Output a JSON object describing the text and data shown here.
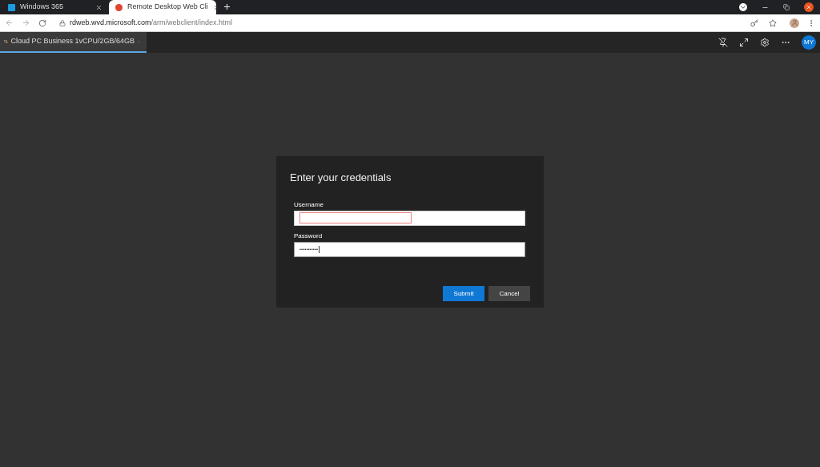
{
  "browser_tabs": [
    {
      "title": "Windows 365",
      "selected": false
    },
    {
      "title": "Remote Desktop Web Cli",
      "selected": true
    }
  ],
  "address_bar": {
    "host": "rdweb.wvd.microsoft.com",
    "path": "/arm/webclient/index.html"
  },
  "session_tab": {
    "title": "Cloud PC Business 1vCPU/2GB/64GB",
    "selected": true
  },
  "account": {
    "initials": "MY"
  },
  "dialog": {
    "title": "Enter your credentials",
    "fields": [
      {
        "label": "Username",
        "invalid": true,
        "kind": "text"
      },
      {
        "label": "Password",
        "value": "•••••••••••",
        "invalid": false,
        "kind": "password"
      }
    ],
    "buttons": [
      {
        "label": "Submit",
        "primary": true
      },
      {
        "label": "Cancel",
        "primary": false
      }
    ]
  }
}
